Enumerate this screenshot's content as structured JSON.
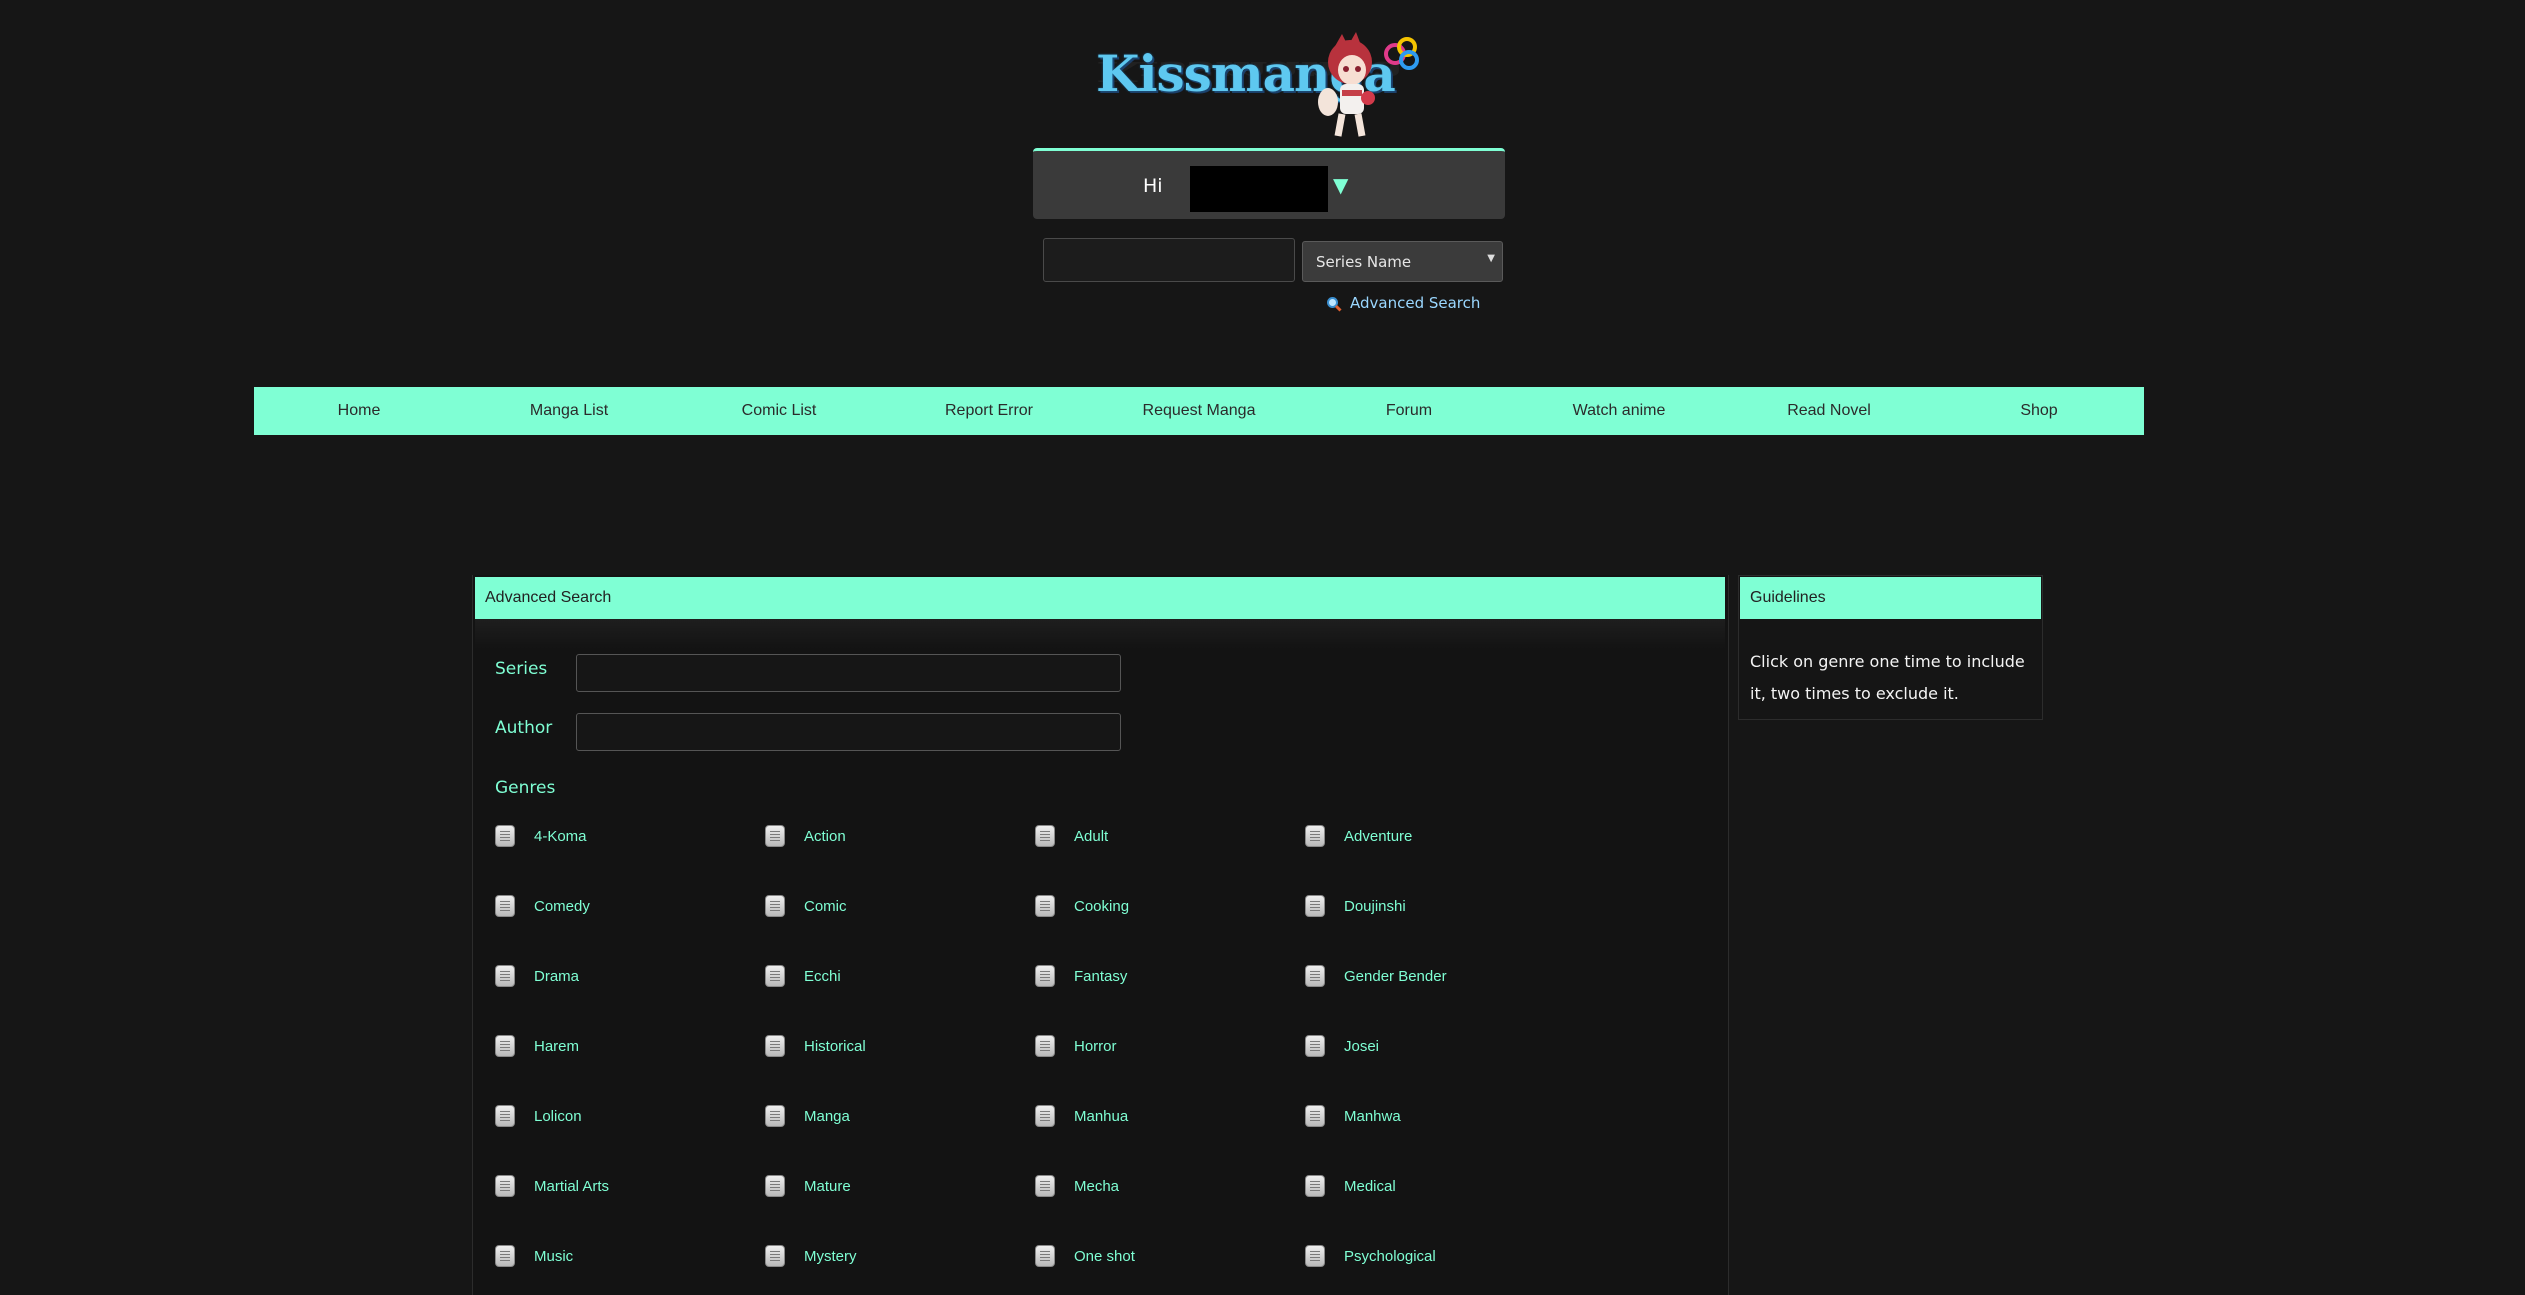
{
  "header": {
    "logo_text": "Kissmanga",
    "greeting": "Hi"
  },
  "search": {
    "type_selected": "Series Name",
    "advanced_link": "Advanced Search"
  },
  "nav": {
    "items": [
      "Home",
      "Manga List",
      "Comic List",
      "Report Error",
      "Request Manga",
      "Forum",
      "Watch anime",
      "Read Novel",
      "Shop"
    ]
  },
  "advanced_search": {
    "title": "Advanced Search",
    "series_label": "Series",
    "author_label": "Author",
    "genres_label": "Genres",
    "genres": [
      "4-Koma",
      "Action",
      "Adult",
      "Adventure",
      "Comedy",
      "Comic",
      "Cooking",
      "Doujinshi",
      "Drama",
      "Ecchi",
      "Fantasy",
      "Gender Bender",
      "Harem",
      "Historical",
      "Horror",
      "Josei",
      "Lolicon",
      "Manga",
      "Manhua",
      "Manhwa",
      "Martial Arts",
      "Mature",
      "Mecha",
      "Medical",
      "Music",
      "Mystery",
      "One shot",
      "Psychological"
    ]
  },
  "guidelines": {
    "title": "Guidelines",
    "text": "Click on genre one time to include it, two times to exclude it."
  },
  "colors": {
    "accent": "#7fffd4",
    "background": "#161616",
    "link": "#9ad7ff"
  }
}
